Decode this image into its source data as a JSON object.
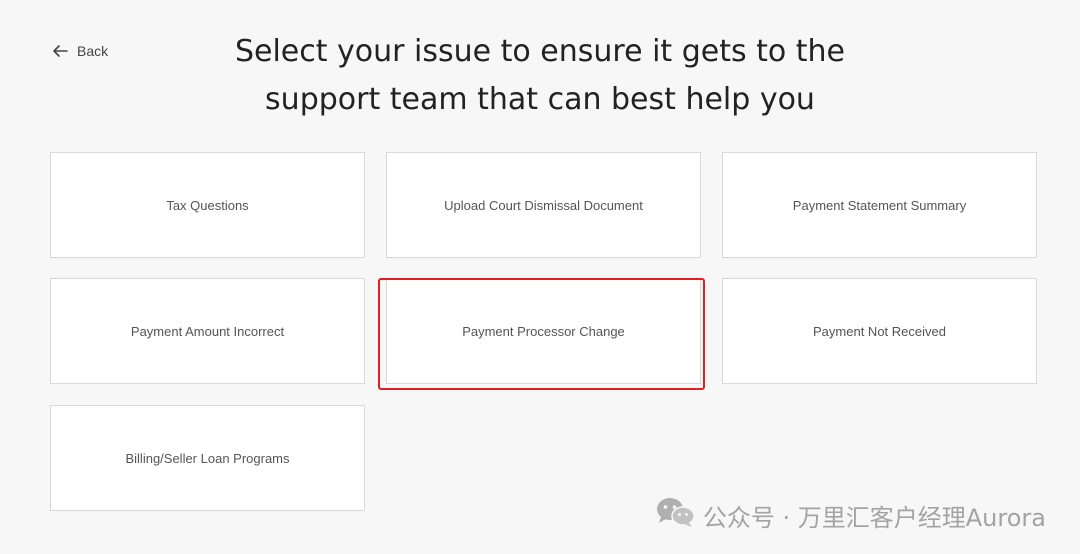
{
  "header": {
    "back_label": "Back",
    "title_line1": "Select your issue to ensure it gets to the",
    "title_line2": "support team that can best help you"
  },
  "options": [
    {
      "label": "Tax Questions"
    },
    {
      "label": "Upload Court Dismissal Document"
    },
    {
      "label": "Payment Statement Summary"
    },
    {
      "label": "Payment Amount Incorrect"
    },
    {
      "label": "Payment Processor Change"
    },
    {
      "label": "Payment Not Received"
    },
    {
      "label": "Billing/Seller Loan Programs"
    }
  ],
  "highlight": {
    "option_label": "Payment Processor Change",
    "color": "#e02020"
  },
  "watermark": {
    "text": "公众号 · 万里汇客户经理Aurora",
    "icon": "wechat-icon"
  },
  "icons": {
    "back": "arrow-left-icon"
  }
}
